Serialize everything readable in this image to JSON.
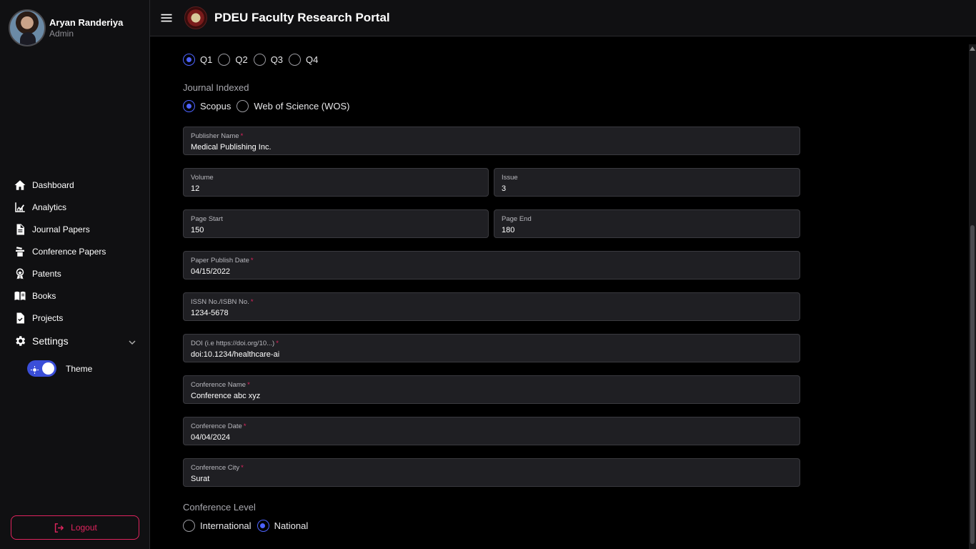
{
  "profile": {
    "name": "Aryan Randeriya",
    "role": "Admin"
  },
  "header": {
    "title": "PDEU Faculty Research Portal"
  },
  "nav": {
    "items": [
      {
        "label": "Dashboard",
        "icon": "home-icon"
      },
      {
        "label": "Analytics",
        "icon": "analytics-icon"
      },
      {
        "label": "Journal Papers",
        "icon": "document-icon"
      },
      {
        "label": "Conference Papers",
        "icon": "podium-icon"
      },
      {
        "label": "Patents",
        "icon": "award-icon"
      },
      {
        "label": "Books",
        "icon": "book-icon"
      },
      {
        "label": "Projects",
        "icon": "task-icon"
      }
    ],
    "settings_label": "Settings",
    "theme_label": "Theme",
    "logout_label": "Logout"
  },
  "form": {
    "quartile": {
      "options": [
        "Q1",
        "Q2",
        "Q3",
        "Q4"
      ],
      "selected": "Q1"
    },
    "journal_indexed": {
      "label": "Journal Indexed",
      "options": [
        "Scopus",
        "Web of Science (WOS)"
      ],
      "selected": "Scopus"
    },
    "publisher_name": {
      "label": "Publisher Name",
      "value": "Medical Publishing Inc."
    },
    "volume": {
      "label": "Volume",
      "value": "12"
    },
    "issue": {
      "label": "Issue",
      "value": "3"
    },
    "page_start": {
      "label": "Page Start",
      "value": "150"
    },
    "page_end": {
      "label": "Page End",
      "value": "180"
    },
    "publish_date": {
      "label": "Paper Publish Date",
      "value": "04/15/2022"
    },
    "issn": {
      "label": "ISSN No./ISBN No.",
      "value": "1234-5678"
    },
    "doi": {
      "label": "DOI (i.e https://doi.org/10...)",
      "value": "doi:10.1234/healthcare-ai"
    },
    "conference_name": {
      "label": "Conference Name",
      "value": "Conference abc xyz"
    },
    "conference_date": {
      "label": "Conference Date",
      "value": "04/04/2024"
    },
    "conference_city": {
      "label": "Conference City",
      "value": "Surat"
    },
    "conference_level": {
      "label": "Conference Level",
      "options": [
        "International",
        "National"
      ],
      "selected": "National"
    }
  },
  "colors": {
    "accent": "#4d63ff",
    "danger": "#e0245e",
    "field_bg": "#1f1f23",
    "sidebar_bg": "#101012"
  }
}
